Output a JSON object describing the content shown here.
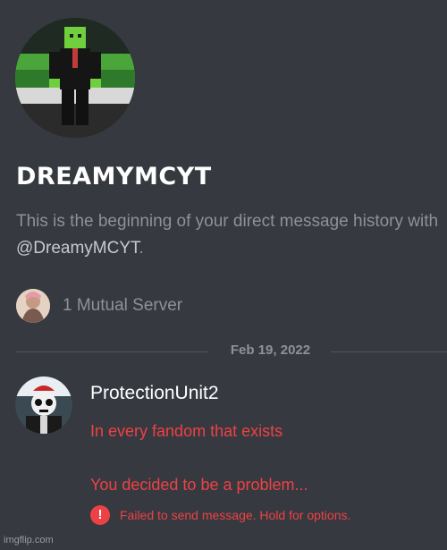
{
  "profile": {
    "username": "DREAMYMCYT",
    "avatar_icon": "minecraft-skin-avatar"
  },
  "intro": {
    "line1": "This is the beginning of your direct message history with",
    "handle": "@DreamyMCYT",
    "handle_suffix": "."
  },
  "mutual": {
    "text": "1 Mutual Server",
    "icon": "server-icon"
  },
  "divider": {
    "date": "Feb 19, 2022"
  },
  "message": {
    "author": "ProtectionUnit2",
    "lines": [
      "In every fandom that exists",
      "You decided to be a problem..."
    ],
    "error_icon": "!",
    "error_text": "Failed to send message. Hold for options."
  },
  "watermark": "imgflip.com",
  "colors": {
    "background": "#36393f",
    "error": "#ed4245",
    "muted": "#8e9297"
  }
}
